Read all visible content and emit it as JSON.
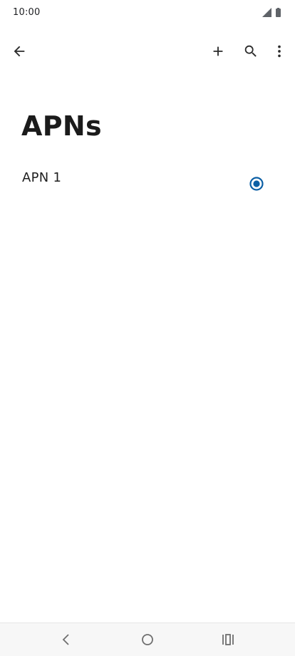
{
  "status_bar": {
    "time": "10:00",
    "signal_icon": "signal-icon",
    "battery_icon": "battery-icon"
  },
  "toolbar": {
    "back_icon": "arrow-back-icon",
    "add_icon": "add-icon",
    "search_icon": "search-icon",
    "more_icon": "more-vert-icon"
  },
  "page": {
    "title": "APNs"
  },
  "apn_list": {
    "items": [
      {
        "name": "APN 1",
        "selected": true
      }
    ]
  },
  "nav_bar": {
    "back_icon": "nav-back-icon",
    "home_icon": "nav-home-icon",
    "recents_icon": "nav-recents-icon"
  },
  "colors": {
    "accent": "#0b5fa5",
    "icon": "#2b2b2b",
    "nav_icon": "#6f6f6f",
    "background": "#ffffff"
  }
}
